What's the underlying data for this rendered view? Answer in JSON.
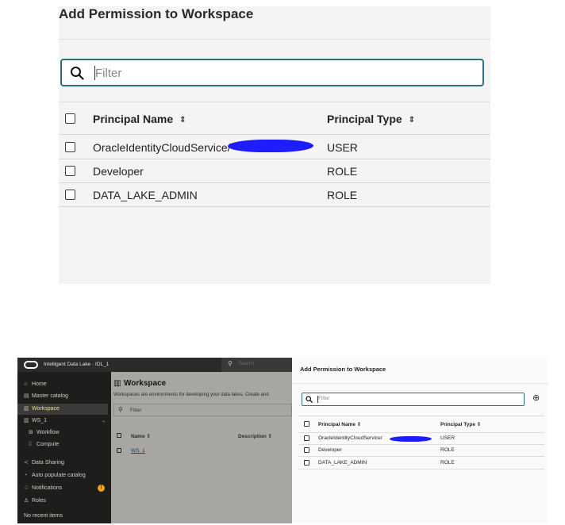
{
  "dialog": {
    "title": "Add Permission to Workspace",
    "filter_placeholder": "Filter",
    "columns": {
      "name": "Principal Name",
      "type": "Principal Type"
    },
    "sort_glyph": "⇕",
    "rows": [
      {
        "name": "OracleIdentityCloudService/",
        "redacted": true,
        "type": "USER"
      },
      {
        "name": "Developer",
        "type": "ROLE"
      },
      {
        "name": "DATA_LAKE_ADMIN",
        "type": "ROLE"
      }
    ],
    "redaction_color": "#1d1dff",
    "accent_color": "#2f6e7c"
  },
  "app": {
    "brand": "Intelligent Data Lake · IDL_1",
    "search_placeholder": "Search",
    "sidebar": [
      {
        "icon": "home-icon",
        "glyph": "⌂",
        "label": "Home"
      },
      {
        "icon": "catalog-icon",
        "glyph": "▤",
        "label": "Master catalog"
      },
      {
        "icon": "workspace-icon",
        "glyph": "▥",
        "label": "Workspace",
        "active": true
      },
      {
        "icon": "workspace-icon",
        "glyph": "▥",
        "label": "WS_1",
        "expanded": true
      },
      {
        "icon": "workflow-icon",
        "glyph": "⊞",
        "label": "Workflow",
        "indent": true
      },
      {
        "icon": "compute-icon",
        "glyph": "⁞⁞",
        "label": "Compute",
        "indent": true
      },
      {
        "icon": "share-icon",
        "glyph": "≺",
        "label": "Data Sharing"
      },
      {
        "icon": "auto-catalog-icon",
        "glyph": "◔",
        "label": "Auto populate catalog"
      },
      {
        "icon": "bell-icon",
        "glyph": "♤",
        "label": "Notifications",
        "badge": "!"
      },
      {
        "icon": "roles-icon",
        "glyph": "♙",
        "label": "Roles"
      },
      {
        "icon": "",
        "glyph": "",
        "label": "No recent items"
      }
    ],
    "workspace": {
      "title": "Workspace",
      "description": "Workspaces are environments for developing your data lakes. Create and",
      "filter_placeholder": "Filter",
      "columns": {
        "name": "Name",
        "description": "Description"
      },
      "rows": [
        {
          "name": "WS_1"
        }
      ]
    },
    "dialog_add_glyph": "⊕"
  }
}
